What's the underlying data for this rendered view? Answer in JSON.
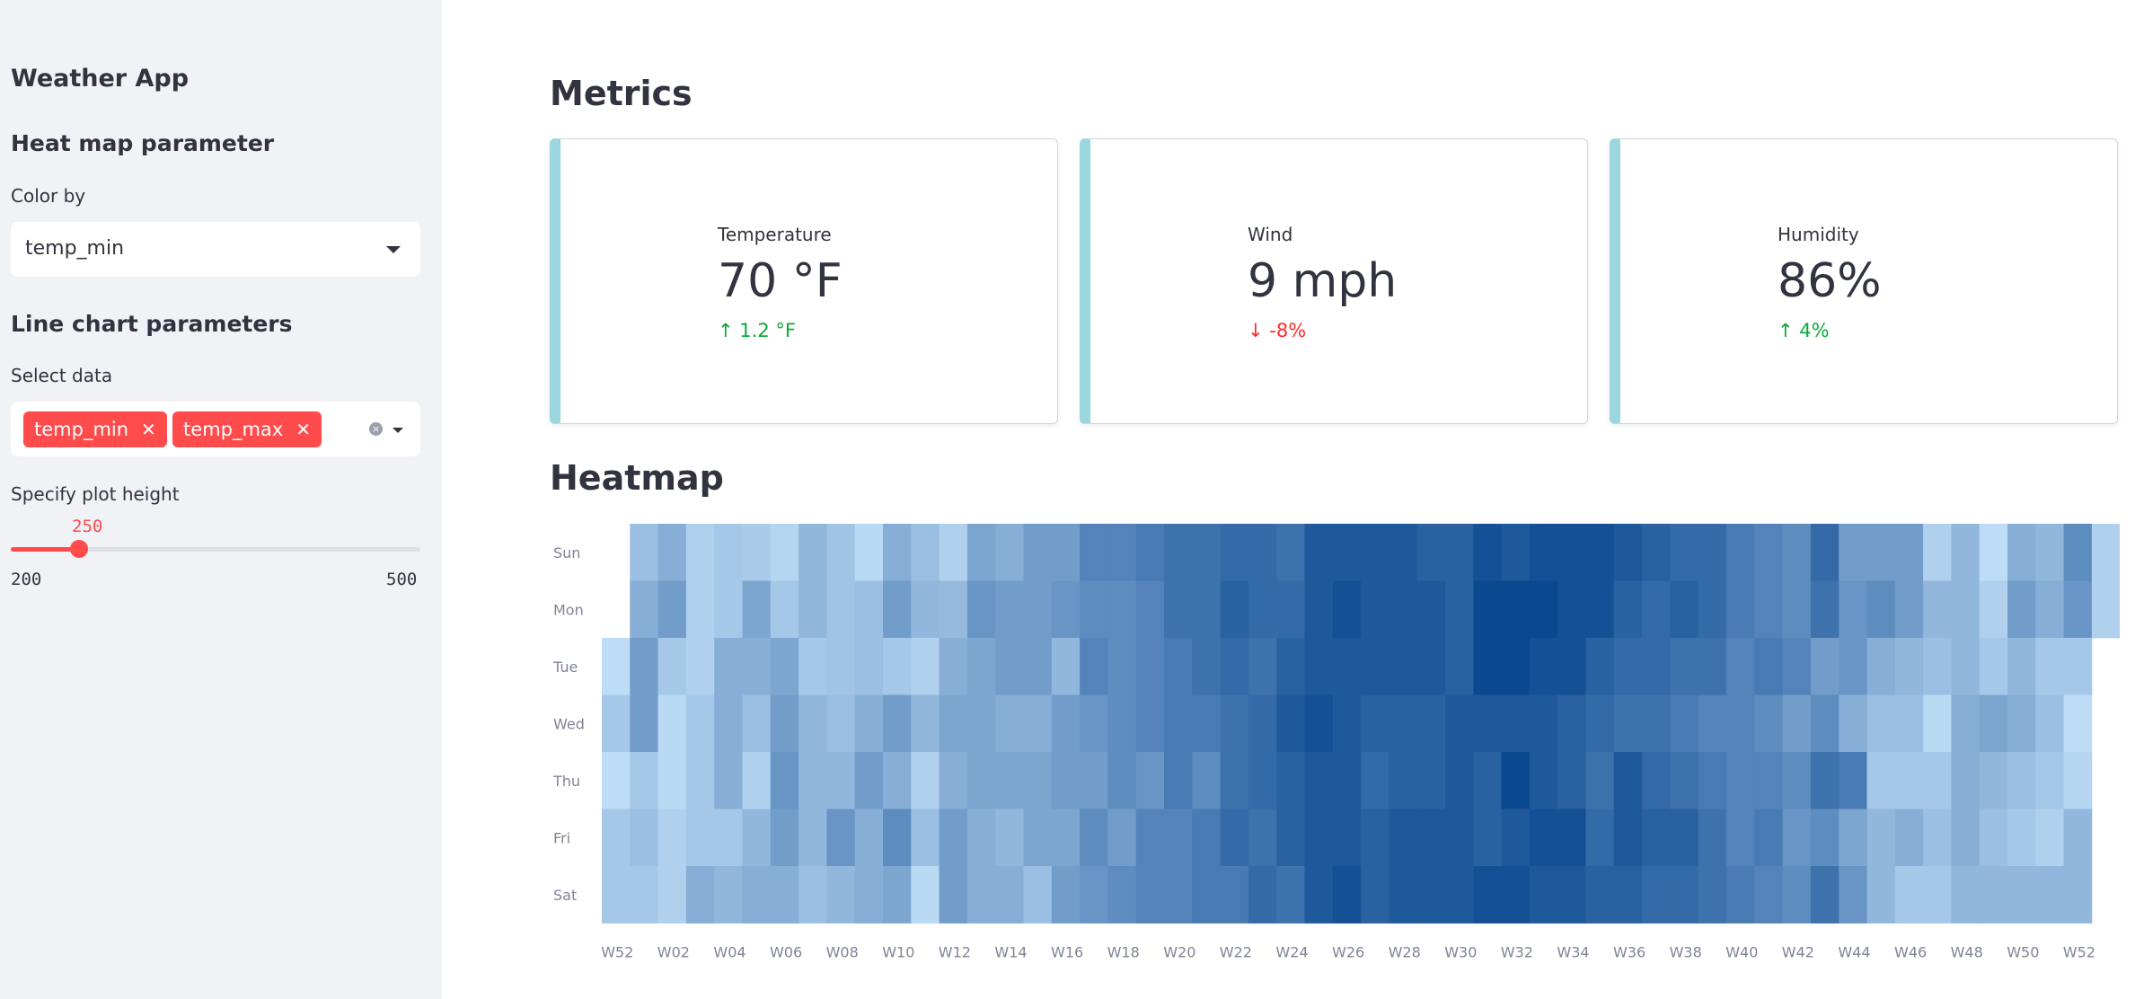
{
  "sidebar": {
    "app_title": "Weather App",
    "heatmap_section": "Heat map parameter",
    "color_by_label": "Color by",
    "color_by_value": "temp_min",
    "line_section": "Line chart parameters",
    "select_data_label": "Select data",
    "selected_tags": [
      "temp_min",
      "temp_max"
    ],
    "tag_remove_glyph": "✕",
    "plot_height_label": "Specify plot height",
    "slider": {
      "value": 250,
      "min": 200,
      "max": 500,
      "value_text": "250",
      "min_text": "200",
      "max_text": "500"
    }
  },
  "main": {
    "metrics_title": "Metrics",
    "heatmap_title": "Heatmap",
    "metrics": [
      {
        "label": "Temperature",
        "value": "70 °F",
        "delta": "1.2 °F",
        "direction": "up"
      },
      {
        "label": "Wind",
        "value": "9 mph",
        "delta": "-8%",
        "direction": "down"
      },
      {
        "label": "Humidity",
        "value": "86%",
        "delta": "4%",
        "direction": "up"
      }
    ]
  },
  "colors": {
    "accent": "#ff4b4b",
    "sidebar_bg": "#f0f2f6",
    "metric_border": "#9ad7de",
    "delta_up": "#09ab3b",
    "delta_down": "#ff2b2b",
    "heat_low": "#cfeaff",
    "heat_high": "#003f8a"
  },
  "chart_data": {
    "type": "heatmap",
    "title": "",
    "y_labels": [
      "Sun",
      "Mon",
      "Tue",
      "Wed",
      "Thu",
      "Fri",
      "Sat"
    ],
    "x_tick_labels": [
      "W52",
      "W02",
      "W04",
      "W06",
      "W08",
      "W10",
      "W12",
      "W14",
      "W16",
      "W18",
      "W20",
      "W22",
      "W24",
      "W26",
      "W28",
      "W30",
      "W32",
      "W34",
      "W36",
      "W38",
      "W40",
      "W42",
      "W44",
      "W46",
      "W48",
      "W50",
      "W52"
    ],
    "columns": 54,
    "value_scale": "relative intensity 0 (lightest) to 1 (darkest)",
    "values": [
      [
        null,
        0.25,
        0.35,
        0.15,
        0.2,
        0.18,
        0.12,
        0.3,
        0.22,
        0.1,
        0.35,
        0.25,
        0.15,
        0.4,
        0.35,
        0.45,
        0.45,
        0.6,
        0.6,
        0.65,
        0.7,
        0.7,
        0.75,
        0.75,
        0.7,
        0.85,
        0.85,
        0.85,
        0.85,
        0.8,
        0.8,
        0.9,
        0.85,
        0.9,
        0.9,
        0.9,
        0.85,
        0.8,
        0.75,
        0.75,
        0.65,
        0.6,
        0.55,
        0.75,
        0.45,
        0.45,
        0.45,
        0.15,
        0.3,
        0.08,
        0.35,
        0.3,
        0.55,
        0.15,
        0.1
      ],
      [
        null,
        0.35,
        0.45,
        0.15,
        0.2,
        0.4,
        0.2,
        0.3,
        0.22,
        0.25,
        0.45,
        0.3,
        0.28,
        0.5,
        0.45,
        0.45,
        0.5,
        0.55,
        0.55,
        0.6,
        0.7,
        0.7,
        0.8,
        0.75,
        0.75,
        0.85,
        0.9,
        0.85,
        0.85,
        0.85,
        0.8,
        0.95,
        0.95,
        0.95,
        0.9,
        0.9,
        0.8,
        0.75,
        0.8,
        0.75,
        0.65,
        0.6,
        0.55,
        0.7,
        0.5,
        0.55,
        0.45,
        0.3,
        0.3,
        0.15,
        0.45,
        0.35,
        0.5,
        0.15,
        0.12
      ],
      [
        0.08,
        0.45,
        0.2,
        0.15,
        0.35,
        0.35,
        0.4,
        0.2,
        0.22,
        0.25,
        0.2,
        0.15,
        0.35,
        0.4,
        0.45,
        0.45,
        0.3,
        0.6,
        0.55,
        0.6,
        0.65,
        0.7,
        0.75,
        0.7,
        0.8,
        0.85,
        0.85,
        0.85,
        0.85,
        0.85,
        0.8,
        0.95,
        0.95,
        0.9,
        0.9,
        0.8,
        0.75,
        0.75,
        0.7,
        0.7,
        0.6,
        0.65,
        0.6,
        0.45,
        0.5,
        0.35,
        0.3,
        0.25,
        0.3,
        0.2,
        0.3,
        0.2,
        0.2,
        null
      ],
      [
        0.2,
        0.45,
        0.1,
        0.2,
        0.35,
        0.25,
        0.45,
        0.3,
        0.25,
        0.35,
        0.45,
        0.3,
        0.4,
        0.4,
        0.35,
        0.35,
        0.45,
        0.5,
        0.55,
        0.6,
        0.65,
        0.65,
        0.7,
        0.75,
        0.85,
        0.9,
        0.85,
        0.8,
        0.8,
        0.8,
        0.85,
        0.85,
        0.85,
        0.85,
        0.8,
        0.75,
        0.7,
        0.7,
        0.65,
        0.6,
        0.6,
        0.55,
        0.45,
        0.55,
        0.35,
        0.25,
        0.25,
        0.1,
        0.35,
        0.4,
        0.35,
        0.25,
        0.08,
        null
      ],
      [
        0.08,
        0.2,
        0.1,
        0.2,
        0.35,
        0.15,
        0.5,
        0.3,
        0.3,
        0.45,
        0.35,
        0.15,
        0.35,
        0.4,
        0.4,
        0.4,
        0.45,
        0.45,
        0.55,
        0.5,
        0.65,
        0.55,
        0.7,
        0.75,
        0.8,
        0.85,
        0.85,
        0.75,
        0.8,
        0.8,
        0.85,
        0.8,
        0.95,
        0.85,
        0.8,
        0.7,
        0.85,
        0.75,
        0.7,
        0.65,
        0.6,
        0.6,
        0.55,
        0.7,
        0.65,
        0.2,
        0.2,
        0.2,
        0.35,
        0.3,
        0.25,
        0.2,
        0.12,
        null
      ],
      [
        0.2,
        0.25,
        0.15,
        0.2,
        0.2,
        0.3,
        0.45,
        0.3,
        0.5,
        0.35,
        0.55,
        0.25,
        0.45,
        0.35,
        0.3,
        0.4,
        0.4,
        0.55,
        0.45,
        0.6,
        0.6,
        0.65,
        0.75,
        0.7,
        0.8,
        0.85,
        0.85,
        0.8,
        0.85,
        0.85,
        0.85,
        0.8,
        0.85,
        0.9,
        0.9,
        0.75,
        0.85,
        0.8,
        0.8,
        0.7,
        0.6,
        0.65,
        0.5,
        0.55,
        0.4,
        0.3,
        0.35,
        0.25,
        0.35,
        0.25,
        0.2,
        0.15,
        0.3,
        null
      ],
      [
        0.2,
        0.2,
        0.15,
        0.35,
        0.3,
        0.35,
        0.35,
        0.25,
        0.3,
        0.35,
        0.4,
        0.1,
        0.45,
        0.35,
        0.35,
        0.25,
        0.45,
        0.5,
        0.55,
        0.6,
        0.6,
        0.65,
        0.65,
        0.75,
        0.7,
        0.85,
        0.9,
        0.8,
        0.85,
        0.85,
        0.85,
        0.9,
        0.9,
        0.85,
        0.85,
        0.8,
        0.8,
        0.75,
        0.75,
        0.7,
        0.65,
        0.6,
        0.55,
        0.7,
        0.5,
        0.3,
        0.2,
        0.2,
        0.3,
        0.3,
        0.3,
        0.3,
        0.3,
        null
      ]
    ]
  }
}
